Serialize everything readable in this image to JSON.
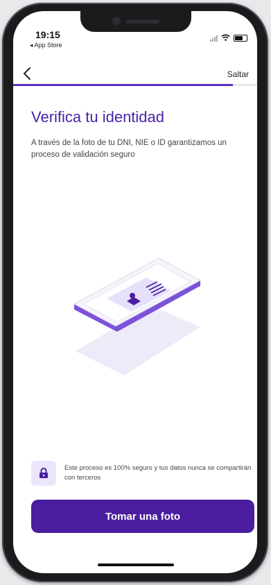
{
  "status_bar": {
    "time": "19:15",
    "back_to_app": "◂ App Store"
  },
  "nav": {
    "skip_label": "Saltar"
  },
  "progress": {
    "fraction": 0.9
  },
  "content": {
    "title": "Verifica tu identidad",
    "subtitle": "A través de la foto de tu DNI, NIE o ID garantizamos un proceso de validación seguro"
  },
  "security": {
    "text": "Este proceso es 100% seguro y tus datos nunca se compartirán con terceros",
    "icon": "lock-icon"
  },
  "cta": {
    "label": "Tomar una foto"
  },
  "colors": {
    "brand": "#4b1ea0",
    "title": "#4b22a8",
    "accent_light": "#ece6fb"
  }
}
